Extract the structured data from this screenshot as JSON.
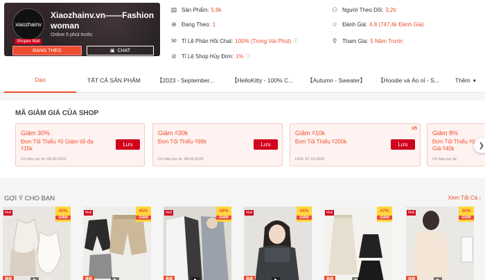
{
  "shop": {
    "logo_text": "xiaozhainv",
    "mall_tag": "Shopee Mall",
    "name": "Xiaozhainv.vn——Fashion woman",
    "online": "Online 5 phút trước",
    "follow_label": "ĐANG THEO",
    "chat_label": "CHAT"
  },
  "stats": {
    "products": {
      "label": "Sản Phẩm:",
      "value": "5,9k",
      "icon": "store-icon"
    },
    "following": {
      "label": "Đang Theo:",
      "value": "1",
      "icon": "user-add-icon"
    },
    "chat_rate": {
      "label": "Tỉ Lệ Phản Hồi Chat:",
      "value": "100% (Trong Vài Phút)",
      "icon": "chat-icon"
    },
    "cancel_rate": {
      "label": "Tỉ Lệ Shop Hủy Đơn:",
      "value": "1%",
      "icon": "cancel-icon"
    },
    "followers": {
      "label": "Người Theo Dõi:",
      "value": "3,2tr",
      "icon": "users-icon"
    },
    "rating": {
      "label": "Đánh Giá:",
      "value": "4.8 (747,4k Đánh Giá)",
      "icon": "star-icon"
    },
    "joined": {
      "label": "Tham Gia:",
      "value": "5 Năm Trước",
      "icon": "user-check-icon"
    }
  },
  "tabs": [
    {
      "label": "Dạo"
    },
    {
      "label": "TẤT CẢ SẢN PHẨM"
    },
    {
      "label": "【2023 - September..."
    },
    {
      "label": "【HelloKitty - 100% C..."
    },
    {
      "label": "【Autumn - Sweater】"
    },
    {
      "label": "【Hoodie và Áo nỉ - S..."
    },
    {
      "label": "Thêm"
    }
  ],
  "vouchers": {
    "title": "MÃ GIẢM GIÁ CỦA SHOP",
    "items": [
      {
        "title": "Giảm 30%",
        "desc": "Đơn Tối Thiểu ₫0 Giảm tối đa ₫15k",
        "expiry": "Có hiệu lực từ: 09.09.2023",
        "button": "Lưu"
      },
      {
        "title": "Giảm ₫30k",
        "desc": "Đơn Tối Thiểu ₫99k",
        "expiry": "Có hiệu lực từ: 08.09.2023",
        "button": "Lưu"
      },
      {
        "title": "Giảm ₫10k",
        "desc": "Đơn Tối Thiểu ₫200k",
        "expiry": "HSD: 07.10.2023",
        "button": "Lưu",
        "badge": "x5"
      },
      {
        "title": "Giảm 8%",
        "desc": "Đơn Tối Thiểu ₫0 Giả ₫40k",
        "expiry": "Có hiệu lực từ:",
        "button": "Lưu"
      }
    ]
  },
  "suggestions": {
    "title": "GỢI Ý CHO BẠN",
    "see_all": "Xem Tất Cả",
    "products": [
      {
        "discount": "45%",
        "tag": "Mall",
        "price": "88",
        "sub": "GIẢM"
      },
      {
        "discount": "45%",
        "tag": "Mall",
        "price": "88",
        "sub": "GIẢM"
      },
      {
        "discount": "49%",
        "tag": "Mall",
        "price": "88",
        "sub": "GIẢM"
      },
      {
        "discount": "44%",
        "tag": "Mall",
        "price": "88",
        "sub": "GIẢM"
      },
      {
        "discount": "47%",
        "tag": "Mall",
        "price": "88",
        "sub": "GIẢM"
      },
      {
        "discount": "50%",
        "tag": "Mall",
        "price": "88",
        "sub": "GIẢM"
      }
    ]
  },
  "colors": {
    "accent": "#ee4d2d",
    "mall_red": "#d0011b"
  }
}
